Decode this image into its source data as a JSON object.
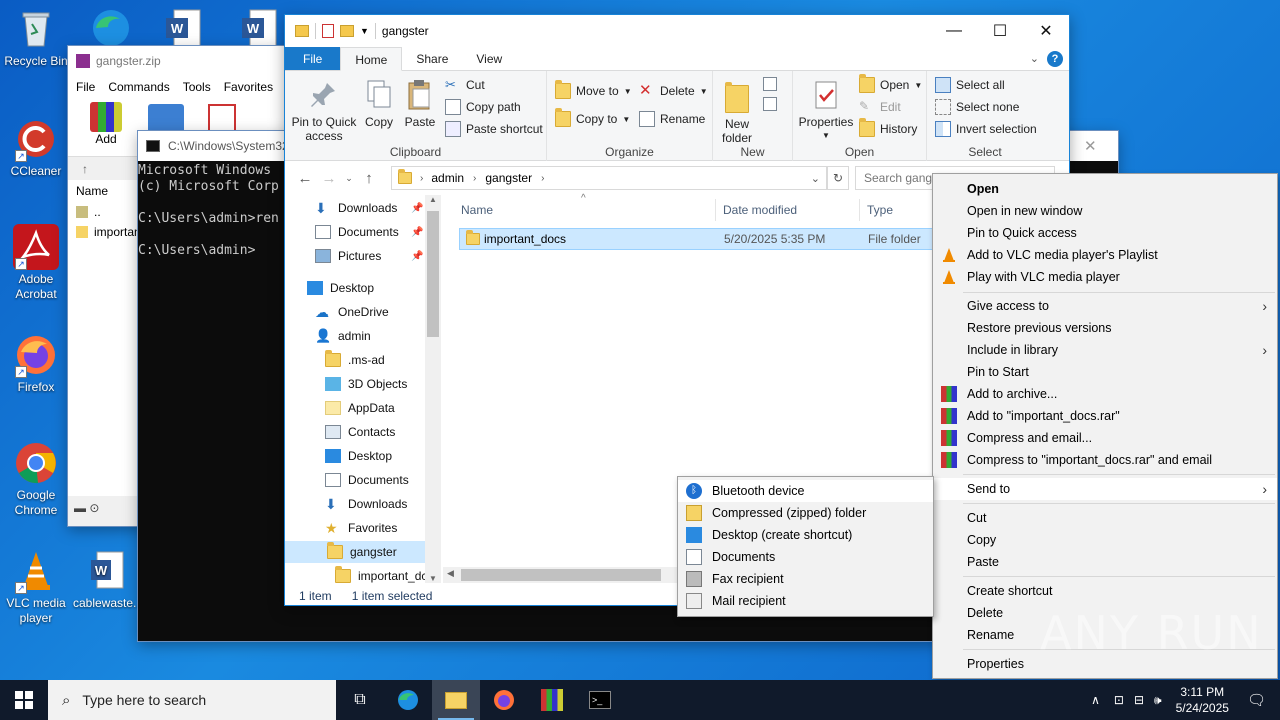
{
  "desktop": {
    "icons": [
      {
        "label": "Recycle Bin"
      },
      {
        "label": "CCleaner"
      },
      {
        "label": "Adobe Acrobat"
      },
      {
        "label": "Firefox"
      },
      {
        "label": "Google Chrome"
      },
      {
        "label": "VLC media player"
      },
      {
        "label": "cablewaste..."
      }
    ]
  },
  "winrar": {
    "title": "gangster.zip",
    "menu": [
      "File",
      "Commands",
      "Tools",
      "Favorites"
    ],
    "add_label": "Add",
    "col_name": "Name",
    "rows": [
      "..",
      "importan"
    ]
  },
  "cmd": {
    "title": "C:\\Windows\\System32",
    "lines": [
      "Microsoft Windows",
      "(c) Microsoft Corp",
      "",
      "C:\\Users\\admin>ren",
      "",
      "C:\\Users\\admin>"
    ]
  },
  "explorer": {
    "title": "gangster",
    "tabs": {
      "file": "File",
      "home": "Home",
      "share": "Share",
      "view": "View"
    },
    "ribbon": {
      "pin": "Pin to Quick access",
      "copy": "Copy",
      "paste": "Paste",
      "cut": "Cut",
      "copy_path": "Copy path",
      "paste_shortcut": "Paste shortcut",
      "clipboard": "Clipboard",
      "move_to": "Move to",
      "copy_to": "Copy to",
      "delete": "Delete",
      "rename": "Rename",
      "organize": "Organize",
      "new_folder": "New folder",
      "new": "New",
      "properties": "Properties",
      "open": "Open",
      "edit": "Edit",
      "history": "History",
      "open_group": "Open",
      "select_all": "Select all",
      "select_none": "Select none",
      "invert": "Invert selection",
      "select": "Select"
    },
    "breadcrumb": [
      "admin",
      "gangster"
    ],
    "search_placeholder": "Search gangs",
    "nav": [
      {
        "label": "Downloads"
      },
      {
        "label": "Documents"
      },
      {
        "label": "Pictures"
      },
      {
        "label": "Desktop"
      },
      {
        "label": "OneDrive"
      },
      {
        "label": "admin"
      },
      {
        "label": ".ms-ad"
      },
      {
        "label": "3D Objects"
      },
      {
        "label": "AppData"
      },
      {
        "label": "Contacts"
      },
      {
        "label": "Desktop"
      },
      {
        "label": "Documents"
      },
      {
        "label": "Downloads"
      },
      {
        "label": "Favorites"
      },
      {
        "label": "gangster"
      },
      {
        "label": "important_dc"
      }
    ],
    "columns": {
      "name": "Name",
      "date": "Date modified",
      "type": "Type"
    },
    "files": [
      {
        "name": "important_docs",
        "date": "5/20/2025 5:35 PM",
        "type": "File folder"
      }
    ],
    "status": {
      "count": "1 item",
      "selected": "1 item selected"
    }
  },
  "context_menu": {
    "items": [
      "Open",
      "Open in new window",
      "Pin to Quick access",
      "Add to VLC media player's Playlist",
      "Play with VLC media player",
      "Give access to",
      "Restore previous versions",
      "Include in library",
      "Pin to Start",
      "Add to archive...",
      "Add to \"important_docs.rar\"",
      "Compress and email...",
      "Compress to \"important_docs.rar\" and email",
      "Send to",
      "Cut",
      "Copy",
      "Paste",
      "Create shortcut",
      "Delete",
      "Rename",
      "Properties"
    ]
  },
  "send_to_menu": {
    "items": [
      "Bluetooth device",
      "Compressed (zipped) folder",
      "Desktop (create shortcut)",
      "Documents",
      "Fax recipient",
      "Mail recipient"
    ]
  },
  "taskbar": {
    "search_placeholder": "Type here to search",
    "time": "3:11 PM",
    "date": "5/24/2025"
  },
  "watermark": "ANY RUN"
}
